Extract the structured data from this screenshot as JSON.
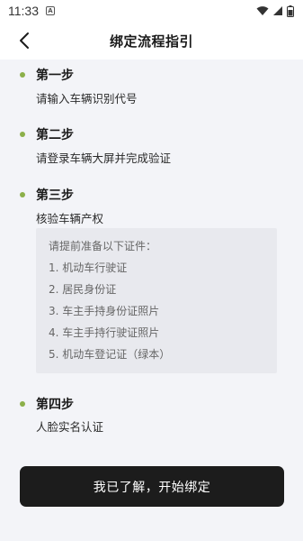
{
  "status_bar": {
    "time": "11:33",
    "notification_glyph": "A"
  },
  "header": {
    "title": "绑定流程指引"
  },
  "steps": [
    {
      "title": "第一步",
      "desc": "请输入车辆识别代号"
    },
    {
      "title": "第二步",
      "desc": "请登录车辆大屏并完成验证"
    },
    {
      "title": "第三步",
      "desc": "核验车辆产权"
    },
    {
      "title": "第四步",
      "desc": "人脸实名认证"
    }
  ],
  "documents": {
    "intro": "请提前准备以下证件：",
    "items": [
      "1. 机动车行驶证",
      "2. 居民身份证",
      "3. 车主手持身份证照片",
      "4. 车主手持行驶证照片",
      "5. 机动车登记证（绿本）"
    ]
  },
  "cta": {
    "label": "我已了解，开始绑定"
  },
  "colors": {
    "accent_dot": "#8cb04a",
    "button_bg": "#1c1c1c",
    "page_bg": "#f3f4f8"
  }
}
